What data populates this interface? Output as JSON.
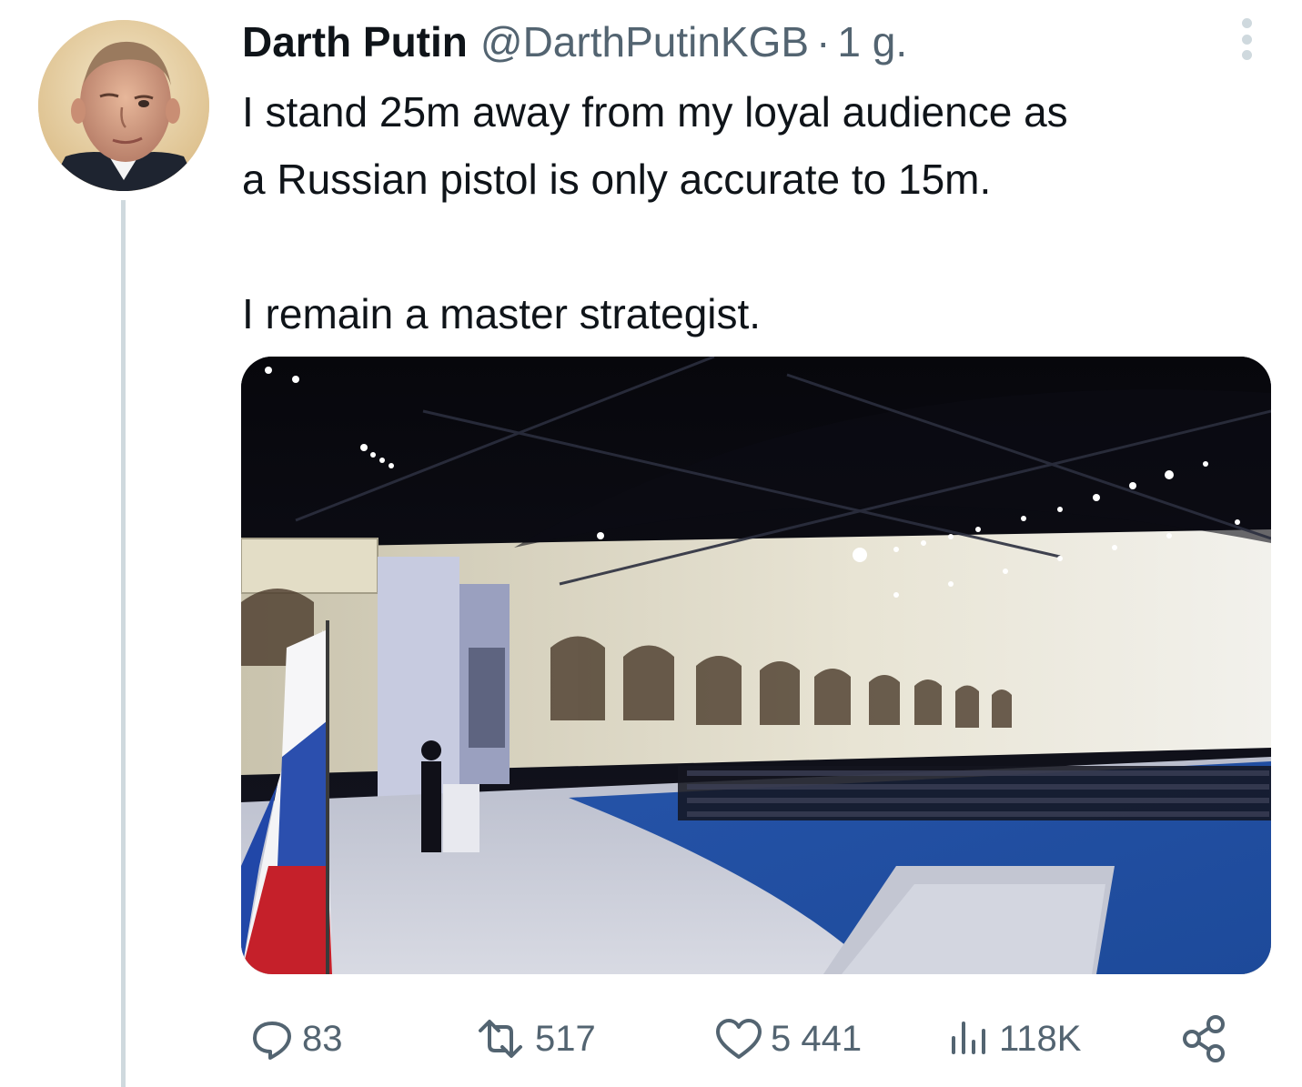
{
  "tweet": {
    "author_name": "Darth Putin",
    "handle": "@DarthPutinKGB",
    "separator": "·",
    "time": "1 g.",
    "text_lines": [
      "I stand 25m away from my loyal audience as",
      "a Russian pistol is only accurate to 15m."
    ],
    "text_para2": "I remain a master strategist.",
    "media": {
      "description_icon": "photo",
      "alt": ""
    }
  },
  "actions": {
    "replies": "83",
    "retweets": "517",
    "likes": "5 441",
    "views": "118K"
  },
  "icons": {
    "more": "more-dots-icon",
    "reply": "reply-bubble-icon",
    "retweet": "retweet-icon",
    "like": "heart-icon",
    "views": "bar-chart-icon",
    "share": "share-icon"
  },
  "colors": {
    "text": "#0f1419",
    "secondary": "#536471",
    "thread_line": "#cfd9de"
  }
}
